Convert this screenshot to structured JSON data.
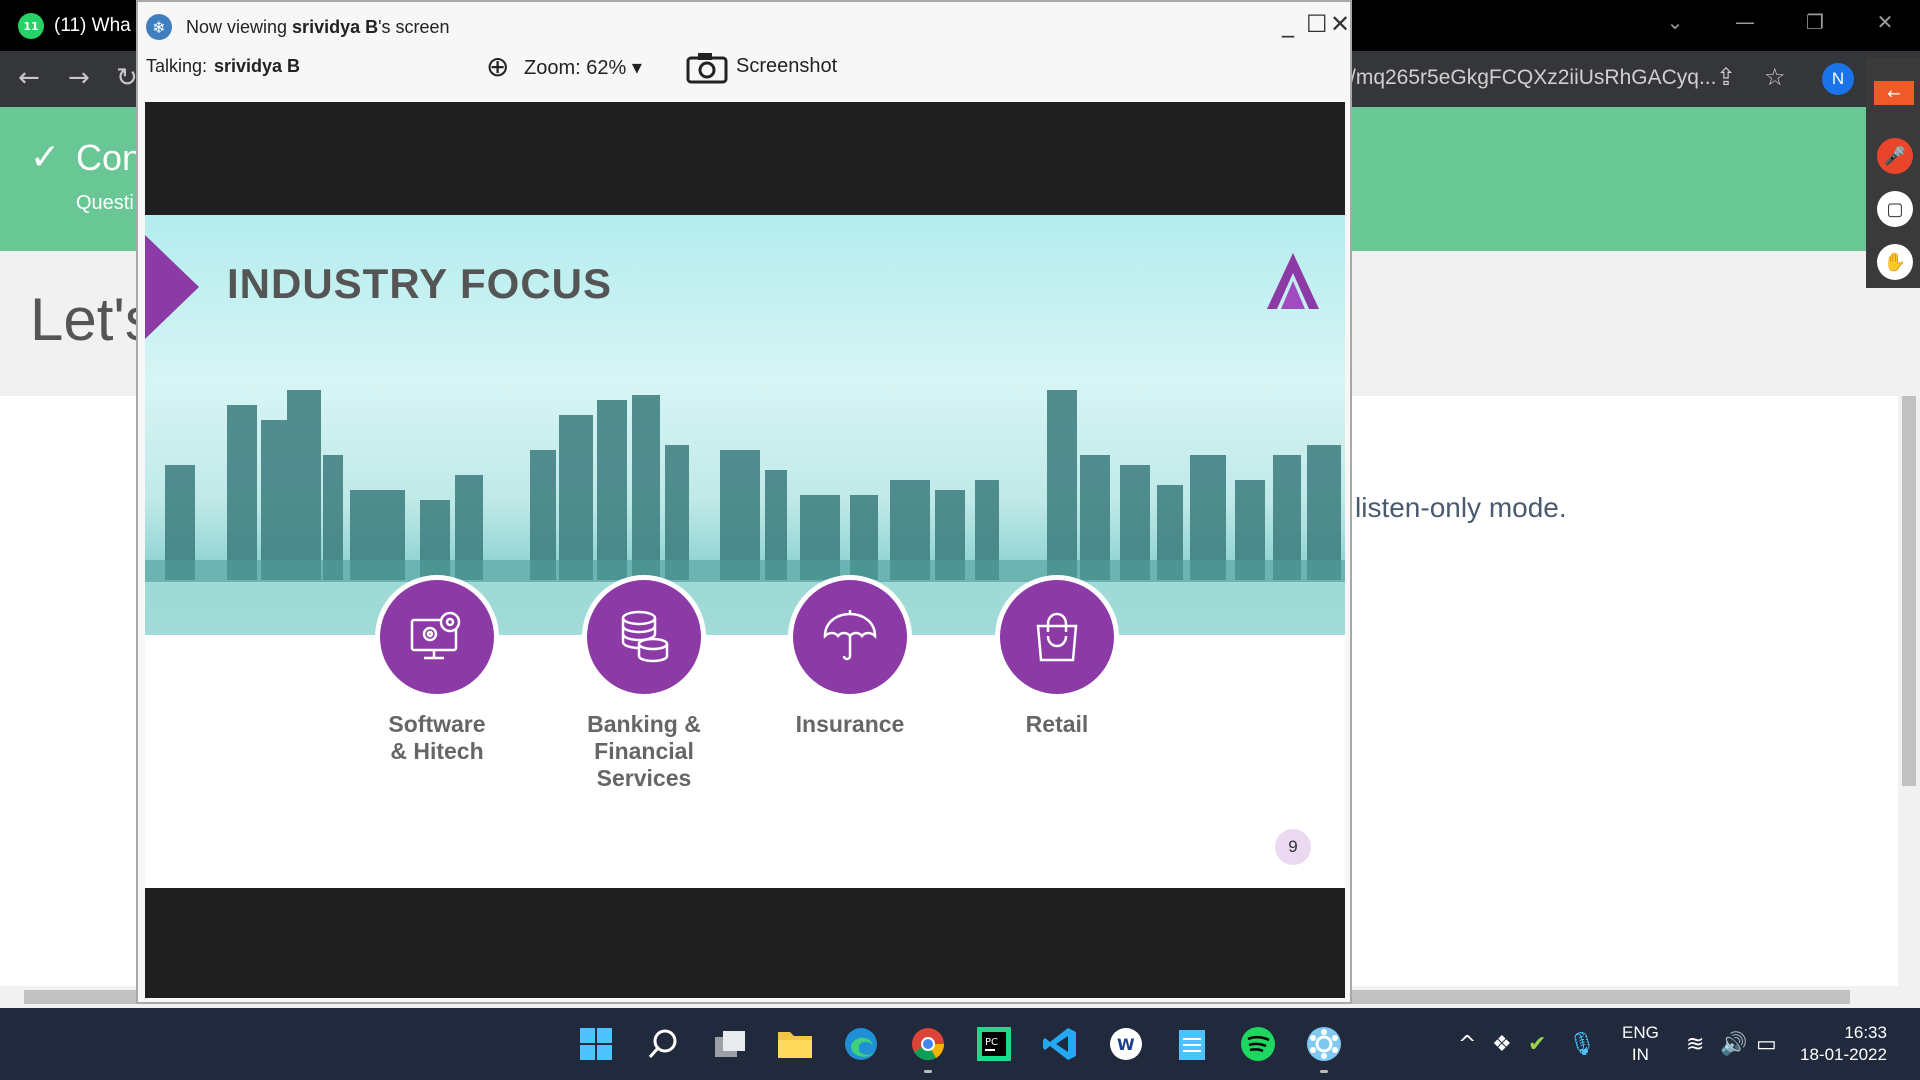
{
  "browser": {
    "tab_title": "(11) Wha",
    "tab_badge": "11",
    "url_partial": "/mq265r5eGkgFCQXz2iiUsRhGACyq...",
    "profile_initial": "N"
  },
  "background_page": {
    "banner_title": "Con",
    "banner_subtitle": "Questi",
    "heading": "Let's",
    "body_text": "listen-only mode."
  },
  "share_window": {
    "title_prefix": "Now viewing ",
    "presenter": "srividya B",
    "title_suffix": "'s screen",
    "talking_label": "Talking:",
    "talking_name": "srividya B",
    "zoom_label": "Zoom: 62%",
    "screenshot_label": "Screenshot"
  },
  "slide": {
    "title": "INDUSTRY FOCUS",
    "page_number": "9",
    "accent_color": "#8c3aa5",
    "items": [
      {
        "label_line1": "Software",
        "label_line2": "& Hitech",
        "label_line3": "",
        "icon": "computer-gears-icon"
      },
      {
        "label_line1": "Banking &",
        "label_line2": "Financial",
        "label_line3": "Services",
        "icon": "coin-stack-icon"
      },
      {
        "label_line1": "Insurance",
        "label_line2": "",
        "label_line3": "",
        "icon": "umbrella-icon"
      },
      {
        "label_line1": "Retail",
        "label_line2": "",
        "label_line3": "",
        "icon": "shopping-bag-icon"
      }
    ]
  },
  "taskbar": {
    "language_line1": "ENG",
    "language_line2": "IN",
    "time": "16:33",
    "date": "18-01-2022"
  }
}
